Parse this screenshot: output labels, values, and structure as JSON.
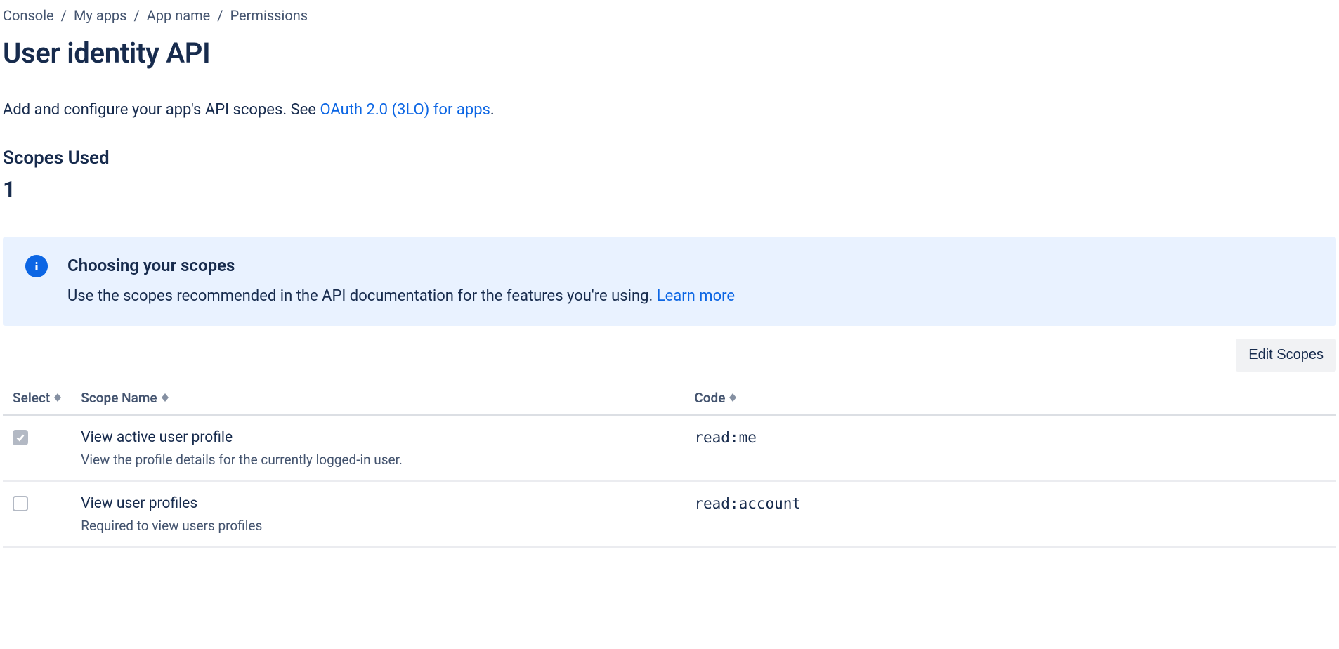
{
  "breadcrumb": {
    "items": [
      "Console",
      "My apps",
      "App name",
      "Permissions"
    ]
  },
  "page_title": "User identity API",
  "intro": {
    "prefix": "Add and configure your app's API scopes. See ",
    "link_text": "OAuth 2.0 (3LO) for apps",
    "suffix": "."
  },
  "scopes_used": {
    "label": "Scopes Used",
    "count": "1"
  },
  "info": {
    "title": "Choosing your scopes",
    "text_prefix": "Use the scopes recommended in the API documentation for the features you're using. ",
    "learn_more": "Learn more"
  },
  "edit_scopes_label": "Edit Scopes",
  "table": {
    "headers": {
      "select": "Select",
      "scope_name": "Scope Name",
      "code": "Code"
    },
    "rows": [
      {
        "checked": true,
        "disabled": true,
        "name": "View active user profile",
        "desc": "View the profile details for the currently logged-in user.",
        "code": "read:me"
      },
      {
        "checked": false,
        "disabled": false,
        "name": "View user profiles",
        "desc": "Required to view users profiles",
        "code": "read:account"
      }
    ]
  }
}
